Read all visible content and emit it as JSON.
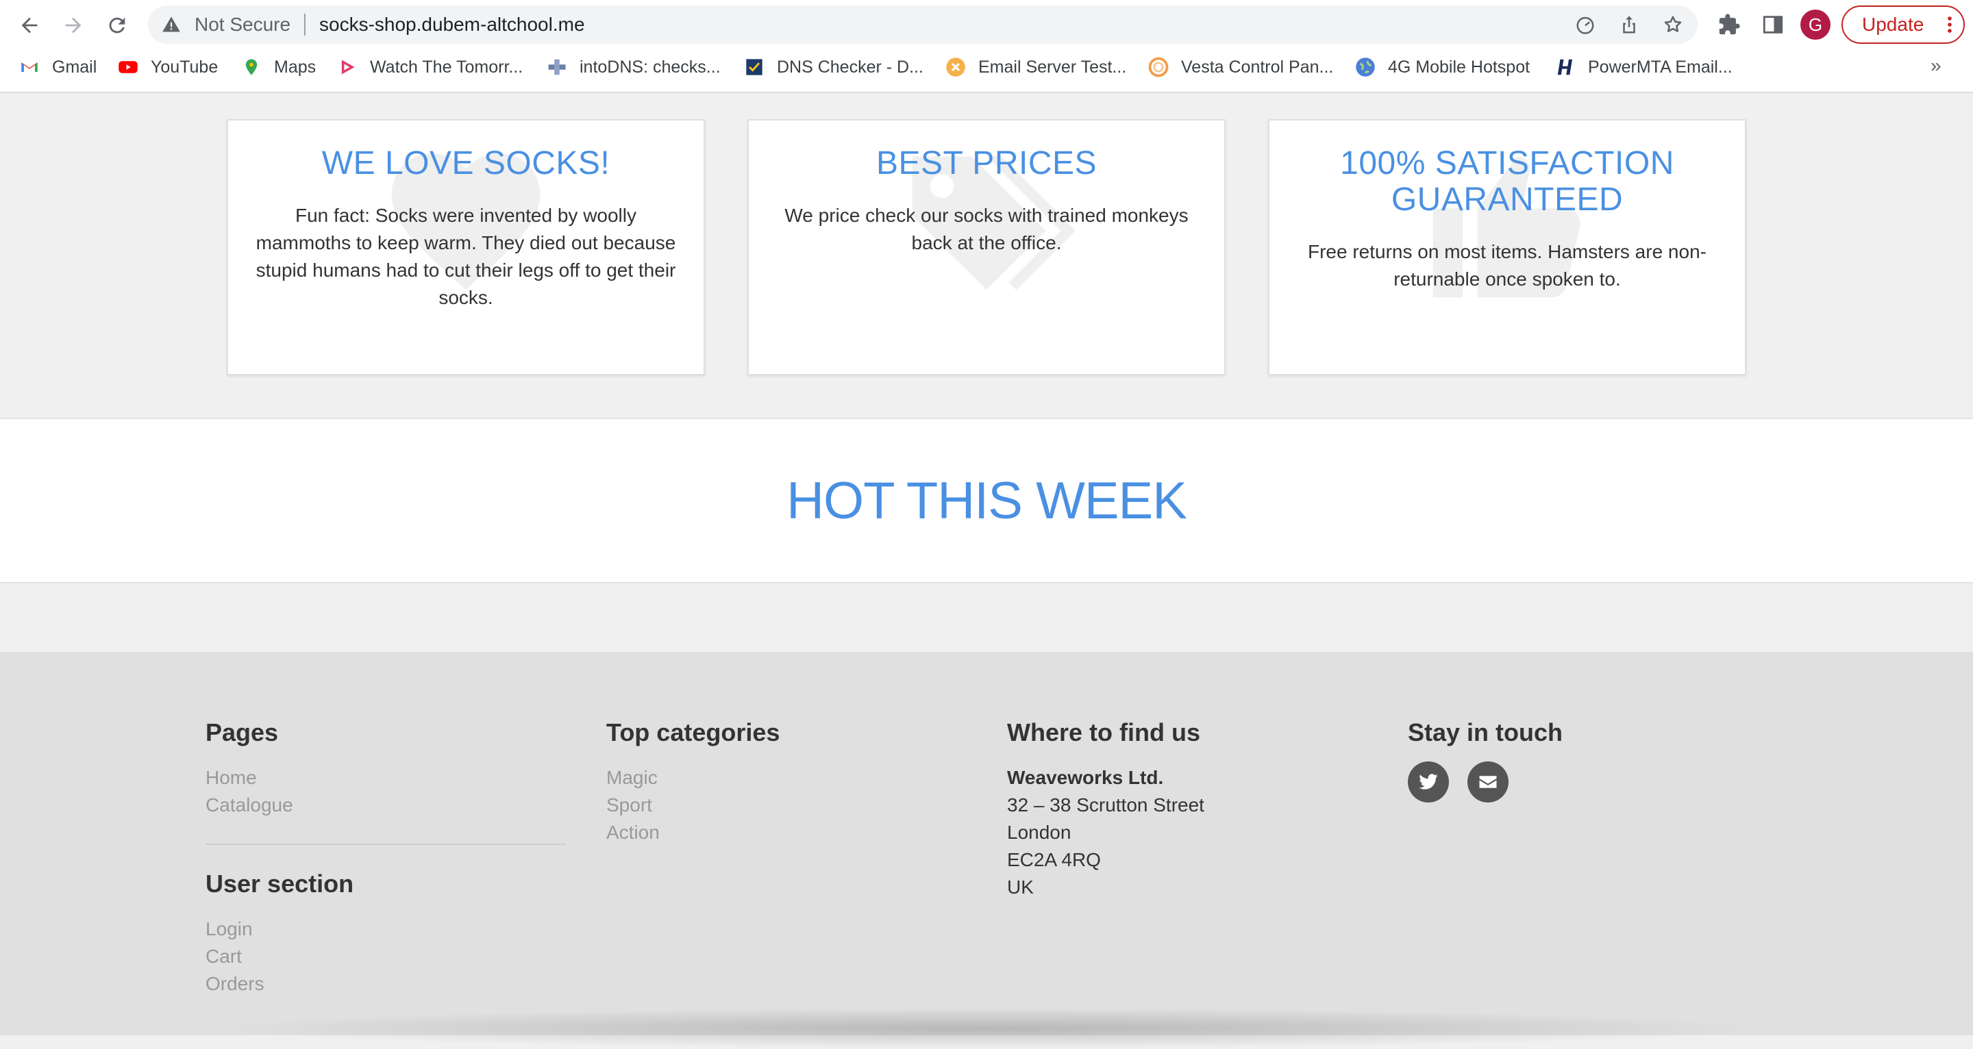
{
  "browser": {
    "security_label": "Not Secure",
    "url": "socks-shop.dubem-altchool.me",
    "profile_initial": "G",
    "update_label": "Update",
    "bookmarks": [
      {
        "label": "Gmail",
        "icon": "gmail-icon"
      },
      {
        "label": "YouTube",
        "icon": "youtube-icon"
      },
      {
        "label": "Maps",
        "icon": "maps-icon"
      },
      {
        "label": "Watch The Tomorr...",
        "icon": "play-icon"
      },
      {
        "label": "intoDNS: checks...",
        "icon": "intodns-icon"
      },
      {
        "label": "DNS Checker - D...",
        "icon": "dns-checker-icon"
      },
      {
        "label": "Email Server Test...",
        "icon": "email-test-icon"
      },
      {
        "label": "Vesta Control Pan...",
        "icon": "vesta-icon"
      },
      {
        "label": "4G Mobile Hotspot",
        "icon": "globe-icon"
      },
      {
        "label": "PowerMTA Email...",
        "icon": "powermta-icon"
      }
    ],
    "bookmarks_more": "»"
  },
  "features": [
    {
      "title": "WE LOVE SOCKS!",
      "text": "Fun fact: Socks were invented by woolly mammoths to keep warm. They died out because stupid humans had to cut their legs off to get their socks.",
      "icon": "heart-icon"
    },
    {
      "title": "BEST PRICES",
      "text": "We price check our socks with trained monkeys back at the office.",
      "icon": "tags-icon"
    },
    {
      "title": "100% SATISFACTION GUARANTEED",
      "text": "Free returns on most items. Hamsters are non-returnable once spoken to.",
      "icon": "thumbs-up-icon"
    }
  ],
  "hot": {
    "title": "HOT THIS WEEK"
  },
  "footer": {
    "pages": {
      "title": "Pages",
      "links": [
        "Home",
        "Catalogue"
      ]
    },
    "user_section": {
      "title": "User section",
      "links": [
        "Login",
        "Cart",
        "Orders"
      ]
    },
    "categories": {
      "title": "Top categories",
      "links": [
        "Magic",
        "Sport",
        "Action"
      ]
    },
    "find_us": {
      "title": "Where to find us",
      "company": "Weaveworks Ltd.",
      "street": "32 – 38 Scrutton Street",
      "city": "London",
      "postcode": "EC2A 4RQ",
      "country": "UK"
    },
    "stay_in_touch": {
      "title": "Stay in touch",
      "icons": [
        "twitter-icon",
        "envelope-icon"
      ]
    }
  },
  "colors": {
    "accent": "#4a90e2",
    "update_red": "#c5221f",
    "avatar": "#b31b47",
    "footer_bg": "#e0e0e0"
  }
}
